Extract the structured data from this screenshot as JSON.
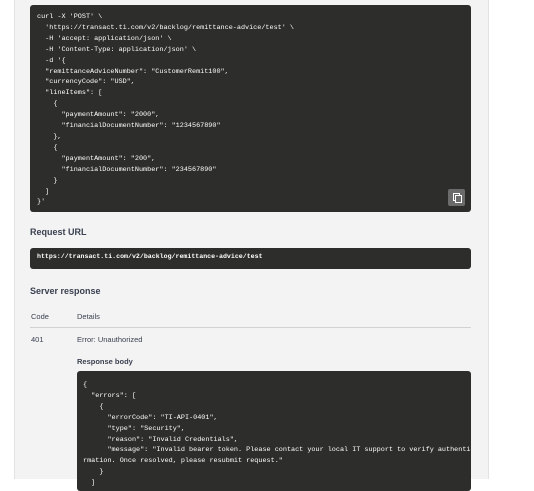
{
  "curl_block": {
    "lines": [
      "curl -X 'POST' \\",
      "  'https://transact.ti.com/v2/backlog/remittance-advice/test' \\",
      "  -H 'accept: application/json' \\",
      "  -H 'Content-Type: application/json' \\",
      "  -d '{",
      "  \"remittanceAdviceNumber\": \"CustomerRemit100\",",
      "  \"currencyCode\": \"USD\",",
      "  \"lineItems\": [",
      "    {",
      "      \"paymentAmount\": \"2000\",",
      "      \"financialDocumentNumber\": \"1234567890\"",
      "    },",
      "    {",
      "      \"paymentAmount\": \"200\",",
      "      \"financialDocumentNumber\": \"234567890\"",
      "    }",
      "  ]",
      "}'"
    ],
    "copy_icon": "copy-icon"
  },
  "request_url": {
    "heading": "Request URL",
    "url": "https://transact.ti.com/v2/backlog/remittance-advice/test"
  },
  "server_response": {
    "heading": "Server response",
    "columns": {
      "code": "Code",
      "details": "Details"
    },
    "row": {
      "code": "401",
      "details": "Error: Unauthorized"
    },
    "response_body_label": "Response body",
    "body_lines": [
      "{",
      "  \"errors\": [",
      "    {",
      "      \"errorCode\": \"TI-API-0401\",",
      "      \"type\": \"Security\",",
      "      \"reason\": \"Invalid Credentials\",",
      "      \"message\": \"Invalid bearer token. Please contact your local IT support to verify authentication info",
      "rmation. Once resolved, please resubmit request.\"",
      "    }",
      "  ]"
    ]
  }
}
